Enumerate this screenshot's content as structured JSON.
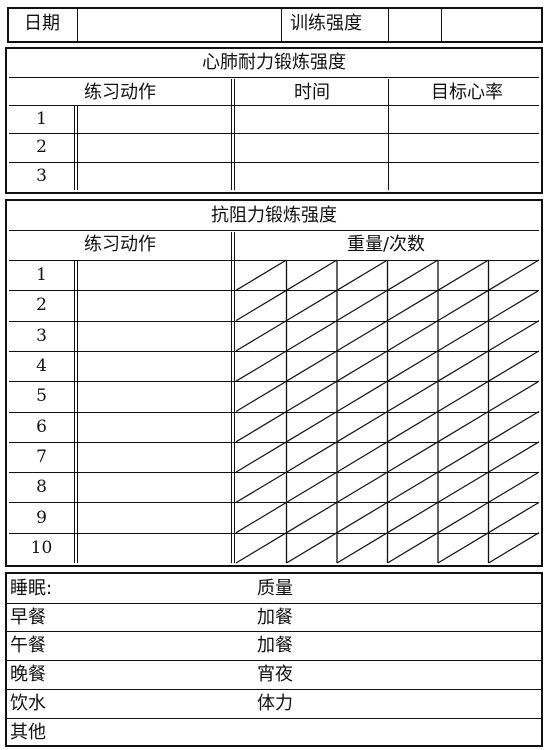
{
  "header": {
    "date_label": "日期",
    "intensity_label": "训练强度"
  },
  "cardio": {
    "title": "心肺耐力锻炼强度",
    "col_exercise": "练习动作",
    "col_time": "时间",
    "col_heart_rate": "目标心率",
    "rows": [
      "1",
      "2",
      "3"
    ]
  },
  "resistance": {
    "title": "抗阻力锻炼强度",
    "col_exercise": "练习动作",
    "col_weight_reps": "重量/次数",
    "rows": [
      "1",
      "2",
      "3",
      "4",
      "5",
      "6",
      "7",
      "8",
      "9",
      "10"
    ]
  },
  "log": {
    "sleep": "睡眠:",
    "quality": "质量",
    "breakfast": "早餐",
    "snack1": "加餐",
    "lunch": "午餐",
    "snack2": "加餐",
    "dinner": "晚餐",
    "late_snack": "宵夜",
    "water": "饮水",
    "energy": "体力",
    "other": "其他"
  }
}
